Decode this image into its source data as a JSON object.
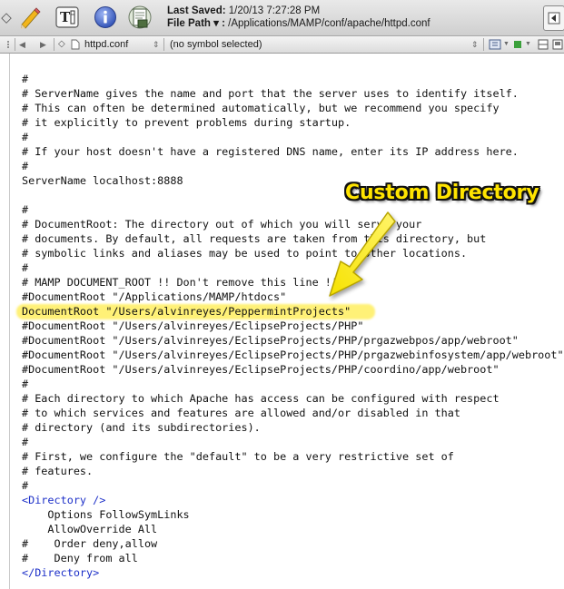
{
  "toolbar": {
    "icons": [
      "diamond-icon",
      "pencil-icon",
      "text-format-icon",
      "info-icon",
      "save-icon"
    ],
    "last_saved_label": "Last Saved:",
    "last_saved_value": "1/20/13 7:27:28 PM",
    "file_path_label": "File Path ▾ :",
    "file_path_value": "/Applications/MAMP/conf/apache/httpd.conf"
  },
  "navbar": {
    "back_arrow": "◀",
    "forward_arrow": "▶",
    "file_name": "httpd.conf",
    "symbol": "(no symbol selected)"
  },
  "code": {
    "lines": [
      "#",
      "# ServerName gives the name and port that the server uses to identify itself.",
      "# This can often be determined automatically, but we recommend you specify",
      "# it explicitly to prevent problems during startup.",
      "#",
      "# If your host doesn't have a registered DNS name, enter its IP address here.",
      "#",
      "ServerName localhost:8888",
      "",
      "#",
      "# DocumentRoot: The directory out of which you will serve your",
      "# documents. By default, all requests are taken from this directory, but",
      "# symbolic links and aliases may be used to point to other locations.",
      "#",
      "# MAMP DOCUMENT_ROOT !! Don't remove this line !!",
      "#DocumentRoot \"/Applications/MAMP/htdocs\"",
      "DocumentRoot \"/Users/alvinreyes/PeppermintProjects\"",
      "#DocumentRoot \"/Users/alvinreyes/EclipseProjects/PHP\"",
      "#DocumentRoot \"/Users/alvinreyes/EclipseProjects/PHP/prgazwebpos/app/webroot\"",
      "#DocumentRoot \"/Users/alvinreyes/EclipseProjects/PHP/prgazwebinfosystem/app/webroot\"",
      "#DocumentRoot \"/Users/alvinreyes/EclipseProjects/PHP/coordino/app/webroot\"",
      "#",
      "# Each directory to which Apache has access can be configured with respect",
      "# to which services and features are allowed and/or disabled in that",
      "# directory (and its subdirectories).",
      "#",
      "# First, we configure the \"default\" to be a very restrictive set of",
      "# features.",
      "#",
      "<Directory />",
      "    Options FollowSymLinks",
      "    AllowOverride All",
      "#    Order deny,allow",
      "#    Deny from all",
      "</Directory>"
    ],
    "highlighted_line": 16,
    "tag_lines": [
      29,
      34
    ]
  },
  "annotation": {
    "label": "Custom Directory",
    "color": "#ffe400"
  },
  "colors": {
    "tag": "#1c2fc8",
    "highlight": "#ffee5f",
    "info_icon": "#4a6ed1"
  }
}
